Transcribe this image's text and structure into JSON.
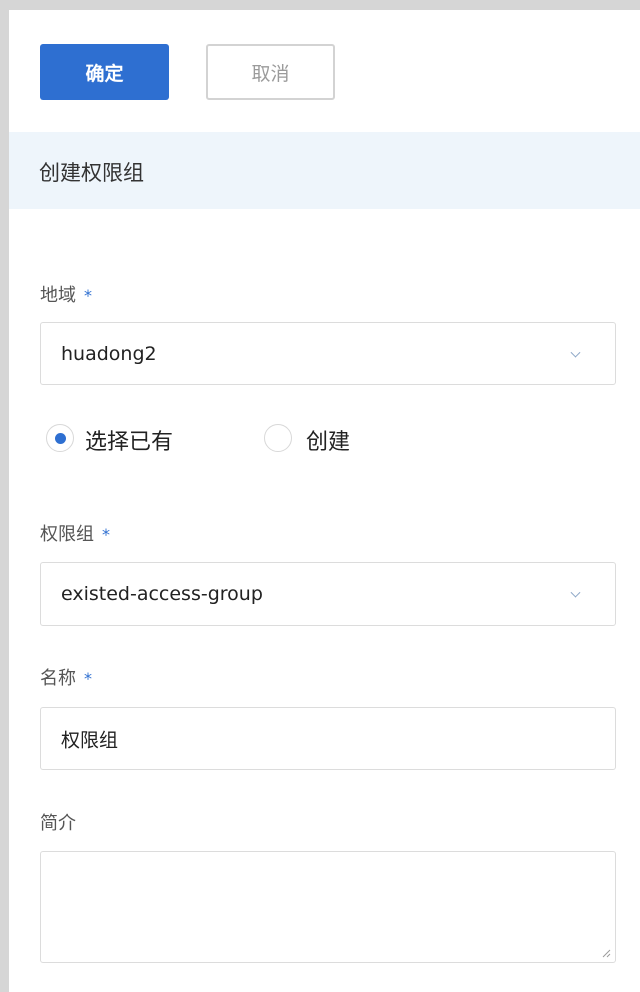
{
  "toolbar": {
    "confirm_label": "确定",
    "cancel_label": "取消"
  },
  "section": {
    "title": "创建权限组"
  },
  "form": {
    "region": {
      "label": "地域",
      "required_mark": "*",
      "value": "huadong2"
    },
    "mode": {
      "options": [
        {
          "label": "选择已有",
          "checked": true
        },
        {
          "label": "创建",
          "checked": false
        }
      ]
    },
    "access_group": {
      "label": "权限组",
      "required_mark": "*",
      "value": "existed-access-group"
    },
    "name": {
      "label": "名称",
      "required_mark": "*",
      "value": "权限组"
    },
    "description": {
      "label": "简介",
      "value": ""
    }
  },
  "colors": {
    "primary": "#2e6fd1",
    "header_bg": "#eef5fb",
    "frame_border": "#d6d6d6"
  }
}
